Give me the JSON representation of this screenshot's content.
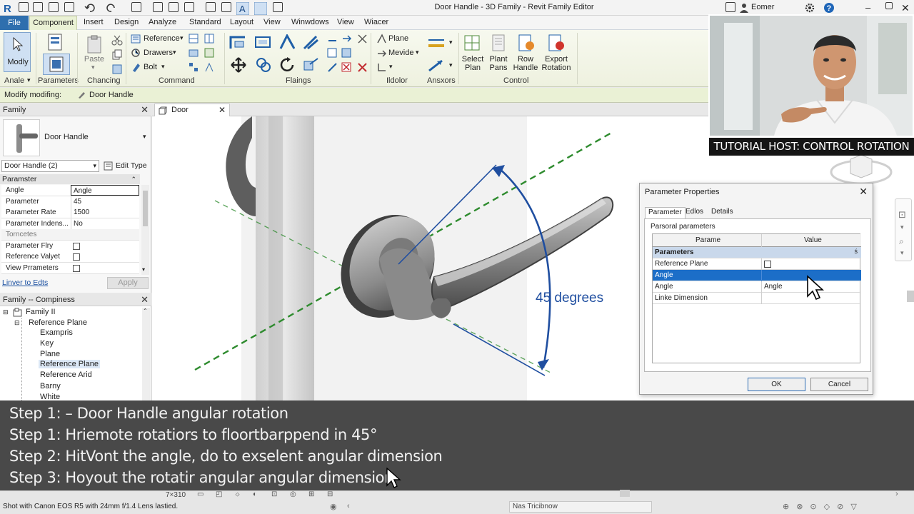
{
  "window": {
    "title": "Door Handle - 3D Family - Revit Family Editor",
    "user": "Eomer"
  },
  "menu": {
    "tabs": [
      "File",
      "Component",
      "Insert",
      "Design",
      "Analyze",
      "Standard",
      "Layout",
      "View",
      "Winwdows",
      "View",
      "Wiacer"
    ]
  },
  "ribbon": {
    "modify": {
      "label": "Modly",
      "group": "Anale"
    },
    "parameters": {
      "group": "Parameters"
    },
    "paste": {
      "label": "Paste",
      "group": "Chancing"
    },
    "command": {
      "reference": "Reference",
      "drawers": "Drawers",
      "bolt": "Bolt",
      "group": "Command"
    },
    "flaings": {
      "group": "Flaings"
    },
    "tools": {
      "plane": "Plane",
      "mevide": "Mevide",
      "group": "Ildolor"
    },
    "ansxors": {
      "group": "Ansxors"
    },
    "control": {
      "buttons": [
        {
          "line1": "Select",
          "line2": "Plan"
        },
        {
          "line1": "Plant",
          "line2": "Pans"
        },
        {
          "line1": "Row",
          "line2": "Handle"
        },
        {
          "line1": "Export",
          "line2": "Rotation"
        }
      ],
      "group": "Control"
    }
  },
  "options_bar": {
    "mode": "Modify modifing:",
    "element": "Door Handle"
  },
  "properties": {
    "header": "Family",
    "type_name": "Door Handle",
    "type_selector": "Door Handle (2)",
    "edit_type": "Edit Type",
    "section": "Paramster",
    "rows": [
      {
        "key": "Angle",
        "value": "Angle"
      },
      {
        "key": "Parameter",
        "value": "45"
      },
      {
        "key": "Parameter Rate",
        "value": "1500"
      },
      {
        "key": "Parameter Indens...",
        "value": "No"
      },
      {
        "key": "Torncetes",
        "value": ""
      },
      {
        "key": "Parameter Flry",
        "value": ""
      },
      {
        "key": "Reference Valyet",
        "value": ""
      },
      {
        "key": "View Prrameters",
        "value": ""
      }
    ],
    "link": "Linver to Edts",
    "apply": "Apply"
  },
  "browser": {
    "header": "Family -- Compiness",
    "root": "Family II",
    "group": "Reference Plane",
    "items": [
      "Exampris",
      "Key",
      "Plane",
      "Reference Plane",
      "Reference Arid",
      "Barny",
      "White"
    ]
  },
  "view": {
    "tab": "Door",
    "annotation": "45 degrees"
  },
  "webcam": {
    "caption": "TUTORIAL HOST: CONTROL ROTATION"
  },
  "dialog": {
    "title": "Parameter Properties",
    "tabs": [
      "Parameter",
      "Edlos",
      "Details"
    ],
    "section_label": "Parsoral parameters",
    "columns": [
      "Parame",
      "Value"
    ],
    "group_row": "Parameters",
    "rows": [
      {
        "name": "Reference Plane",
        "value": ""
      },
      {
        "name": "Angle",
        "value": ""
      },
      {
        "name": "Angle",
        "value": "Angle"
      },
      {
        "name": "Linke Dimension",
        "value": ""
      }
    ],
    "ok": "OK",
    "cancel": "Cancel"
  },
  "subtitles": [
    "Step 1: – Door Handle angular rotation",
    "Step 1: Hriemote rotatiors to floortbarppend in 45°",
    "Step 2: HitVont the angle, do to exselent angular dimension",
    "Step 3: Hoyout the rotatir angular angular dimension"
  ],
  "status": {
    "scale": "7×310",
    "caption": "Shot with Canon EOS R5 with 24mm f/1.4 Lens lastied.",
    "field": "Nas Tricibnow"
  },
  "colors": {
    "file_tab": "#2f6fae",
    "selection": "#1c6ec8",
    "plane_green": "#2e8b2e",
    "dimension_blue": "#1f4ea0"
  }
}
